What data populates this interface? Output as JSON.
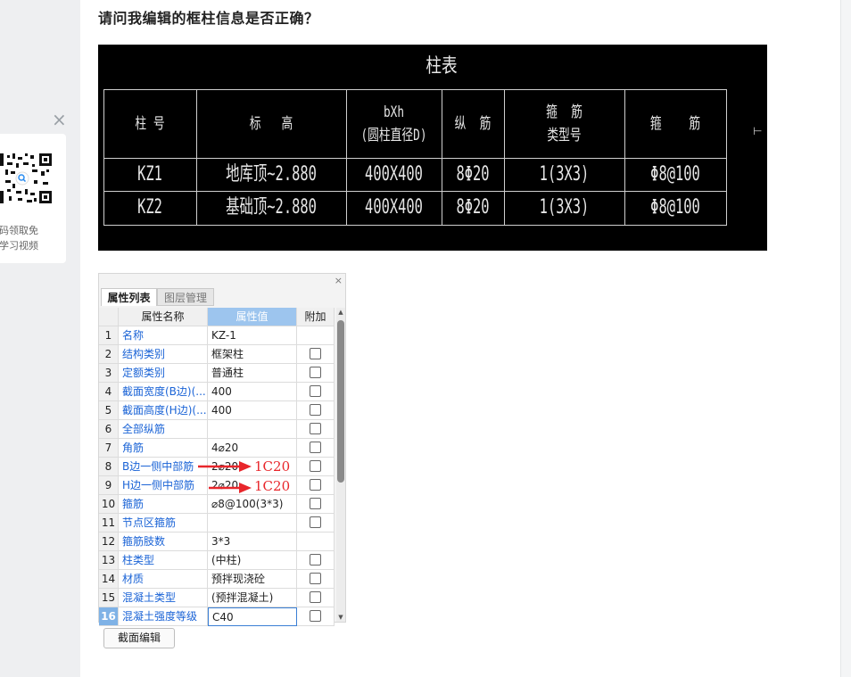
{
  "question": "请问我编辑的框柱信息是否正确？",
  "side_panel": {
    "close_label": "×",
    "qr_line1": "扫码领取免",
    "qr_line2": "费学习视频"
  },
  "cad": {
    "title": "柱表",
    "headers": [
      "柱 号",
      "标   高",
      "bXh\n(圆柱直径D)",
      "纵  筋",
      "箍  筋\n类型号",
      "箍    筋"
    ],
    "rows": [
      [
        "KZ1",
        "地库顶~2.880",
        "400X400",
        "8Φ20",
        "1(3X3)",
        "Φ8@100"
      ],
      [
        "KZ2",
        "基础顶~2.880",
        "400X400",
        "8Φ20",
        "1(3X3)",
        "Φ8@100"
      ]
    ]
  },
  "panel": {
    "close_label": "×",
    "tabs": [
      {
        "label": "属性列表"
      },
      {
        "label": "图层管理"
      }
    ],
    "columns": [
      "属性名称",
      "属性值",
      "附加"
    ],
    "rows": [
      {
        "no": "1",
        "name": "名称",
        "value": "KZ-1",
        "checkbox": false
      },
      {
        "no": "2",
        "name": "结构类别",
        "value": "框架柱",
        "checkbox": true
      },
      {
        "no": "3",
        "name": "定额类别",
        "value": "普通柱",
        "checkbox": true
      },
      {
        "no": "4",
        "name": "截面宽度(B边)(...",
        "value": "400",
        "checkbox": true
      },
      {
        "no": "5",
        "name": "截面高度(H边)(...",
        "value": "400",
        "checkbox": true
      },
      {
        "no": "6",
        "name": "全部纵筋",
        "value": "",
        "checkbox": true
      },
      {
        "no": "7",
        "name": "角筋",
        "value": "4⌀20",
        "checkbox": true
      },
      {
        "no": "8",
        "name": "B边一侧中部筋",
        "value": "2⌀20",
        "checkbox": true
      },
      {
        "no": "9",
        "name": "H边一侧中部筋",
        "value": "2⌀20",
        "checkbox": true
      },
      {
        "no": "10",
        "name": "箍筋",
        "value": "⌀8@100(3*3)",
        "checkbox": true
      },
      {
        "no": "11",
        "name": "节点区箍筋",
        "value": "",
        "checkbox": true
      },
      {
        "no": "12",
        "name": "箍筋肢数",
        "value": "3*3",
        "checkbox": false
      },
      {
        "no": "13",
        "name": "柱类型",
        "value": "(中柱)",
        "checkbox": true
      },
      {
        "no": "14",
        "name": "材质",
        "value": "预拌现浇砼",
        "checkbox": true
      },
      {
        "no": "15",
        "name": "混凝土类型",
        "value": "(预拌混凝土)",
        "checkbox": true
      },
      {
        "no": "16",
        "name": "混凝土强度等级",
        "value": "C40",
        "checkbox": true
      }
    ],
    "button": "截面编辑"
  },
  "annotations": [
    "1C20",
    "1C20"
  ],
  "colors": {
    "annotation": "#e8262b",
    "link_text": "#1a63d6",
    "header_highlight": "#9dc5ee"
  }
}
